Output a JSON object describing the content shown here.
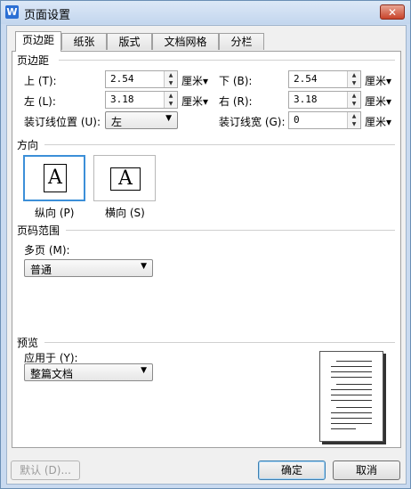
{
  "window": {
    "title": "页面设置",
    "app_icon": "W"
  },
  "tabs": [
    {
      "label": "页边距"
    },
    {
      "label": "纸张"
    },
    {
      "label": "版式"
    },
    {
      "label": "文档网格"
    },
    {
      "label": "分栏"
    }
  ],
  "margins": {
    "section_title": "页边距",
    "top": {
      "label": "上 (T):",
      "value": "2.54",
      "unit": "厘米▾"
    },
    "bottom": {
      "label": "下 (B):",
      "value": "2.54",
      "unit": "厘米▾"
    },
    "left": {
      "label": "左 (L):",
      "value": "3.18",
      "unit": "厘米▾"
    },
    "right": {
      "label": "右 (R):",
      "value": "3.18",
      "unit": "厘米▾"
    },
    "gutter_position": {
      "label": "装订线位置 (U):",
      "value": "左"
    },
    "gutter_width": {
      "label": "装订线宽 (G):",
      "value": "0",
      "unit": "厘米▾"
    }
  },
  "orientation": {
    "section_title": "方向",
    "portrait": {
      "label": "纵向 (P)",
      "glyph": "A",
      "selected": true
    },
    "landscape": {
      "label": "横向 (S)",
      "glyph": "A",
      "selected": false
    }
  },
  "page_range": {
    "section_title": "页码范围",
    "multiple_pages_label": "多页 (M):",
    "multiple_pages_value": "普通"
  },
  "preview": {
    "section_title": "预览",
    "apply_to_label": "应用于 (Y):",
    "apply_to_value": "整篇文档"
  },
  "buttons": {
    "default": "默认 (D)...",
    "ok": "确定",
    "cancel": "取消"
  },
  "colors": {
    "title_bar": "#c9daf0",
    "close": "#c9432a",
    "selection": "#3c8fd8"
  }
}
